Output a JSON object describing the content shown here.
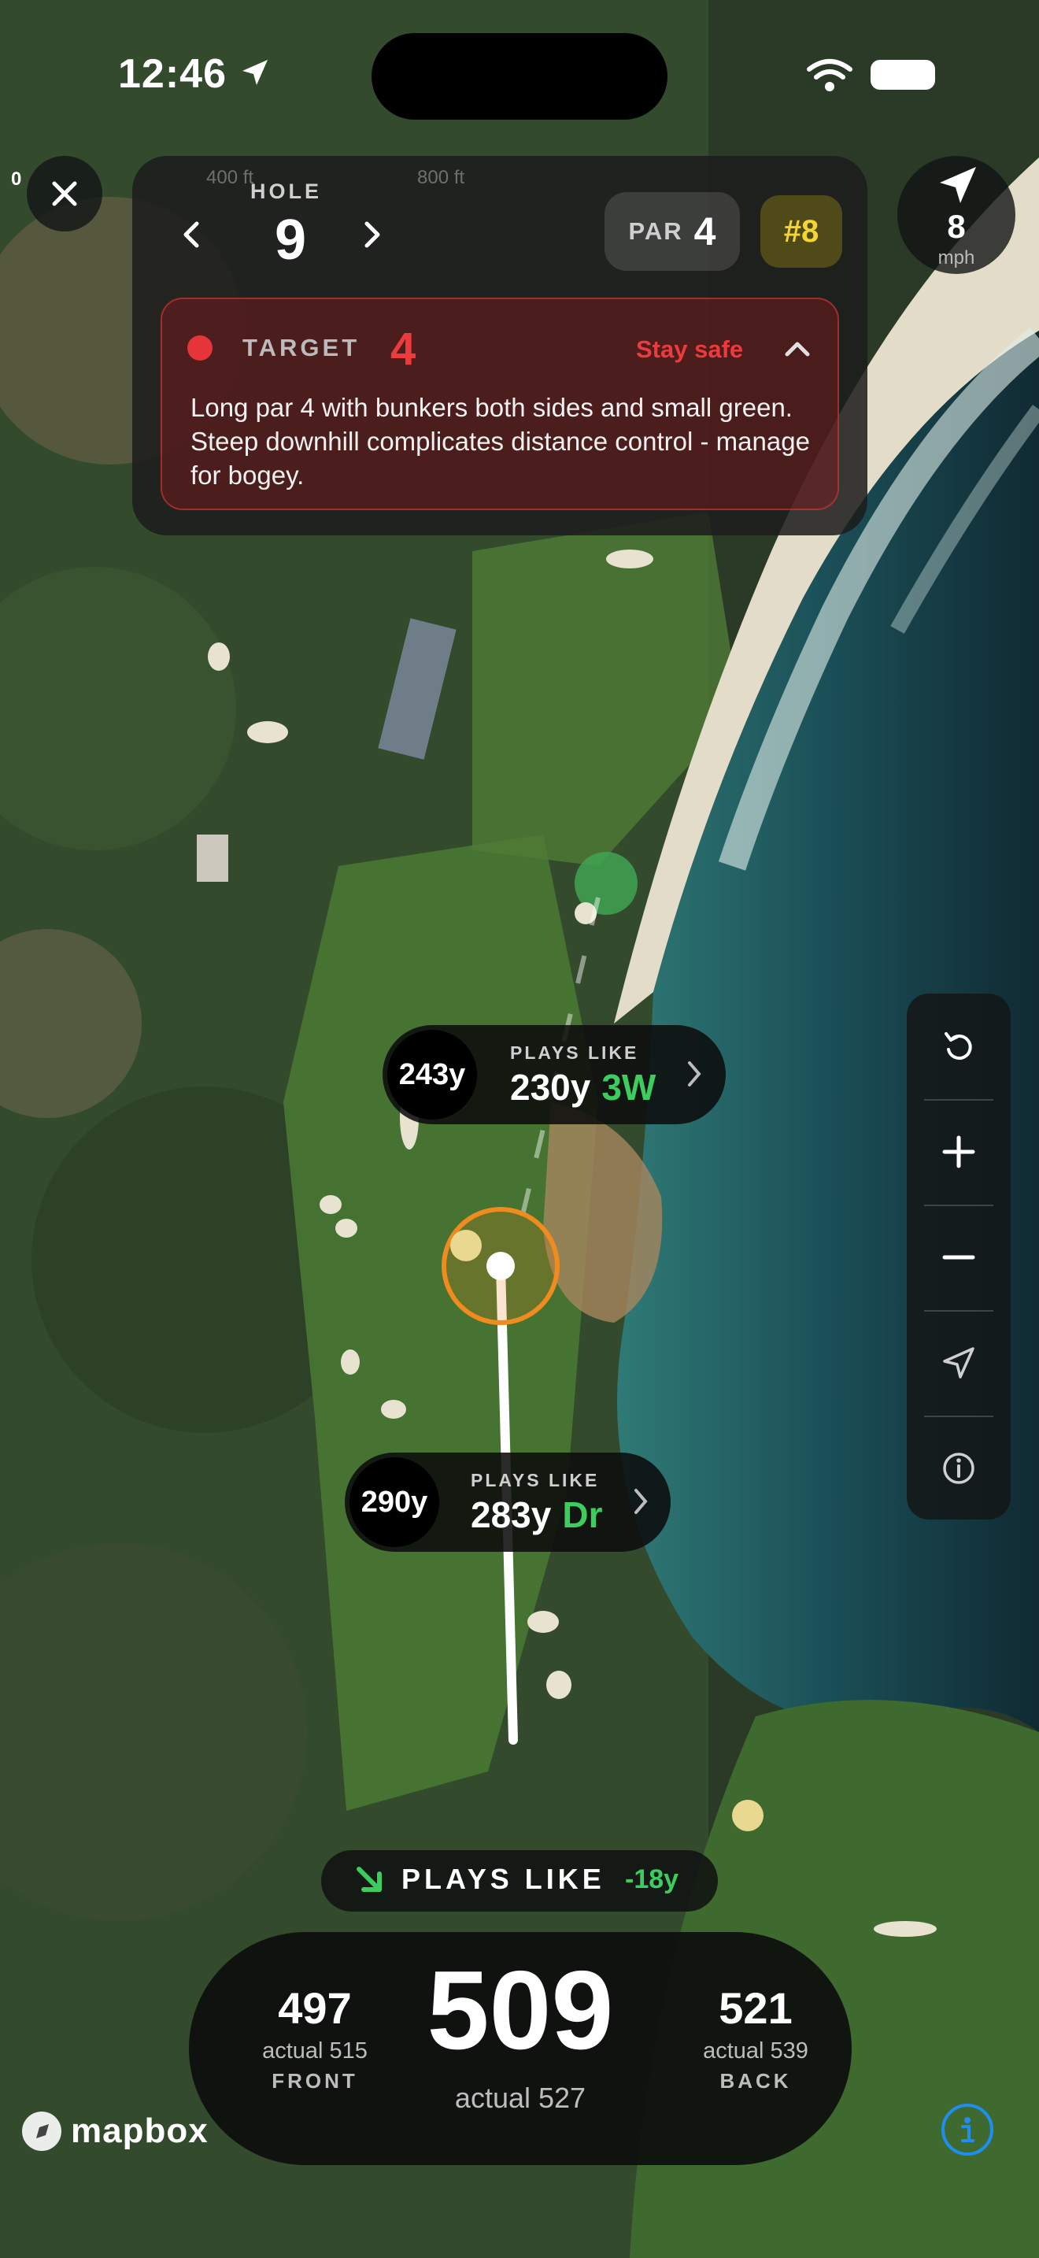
{
  "status_bar": {
    "time": "12:46"
  },
  "hole": {
    "label": "HOLE",
    "number": "9",
    "par_label": "PAR",
    "par_value": "4",
    "handicap": "#8",
    "scale_labels": [
      "400 ft",
      "800 ft"
    ],
    "scale_zero": "0"
  },
  "wind": {
    "speed": "8",
    "unit": "mph"
  },
  "target": {
    "label": "TARGET",
    "number": "4",
    "strategy": "Stay safe",
    "description": "Long par 4 with bunkers both sides and small green. Steep downhill complicates distance control - manage for bogey."
  },
  "shots": [
    {
      "actual": "243y",
      "plays_like_label": "PLAYS LIKE",
      "plays_like": "230y",
      "club": "3W"
    },
    {
      "actual": "290y",
      "plays_like_label": "PLAYS LIKE",
      "plays_like": "283y",
      "club": "Dr"
    }
  ],
  "plays_like_banner": {
    "label": "PLAYS LIKE",
    "adjustment": "-18y"
  },
  "distances": {
    "front": {
      "value": "497",
      "actual": "actual 515",
      "label": "FRONT"
    },
    "center": {
      "value": "509",
      "actual": "actual 527"
    },
    "back": {
      "value": "521",
      "actual": "actual 539",
      "label": "BACK"
    }
  },
  "attribution": {
    "logo_text": "mapbox"
  },
  "colors": {
    "accent_green": "#3ccd5e",
    "danger_red": "#ec3a3d",
    "handicap_yellow": "#f4d533",
    "info_blue": "#1f8ef2"
  }
}
